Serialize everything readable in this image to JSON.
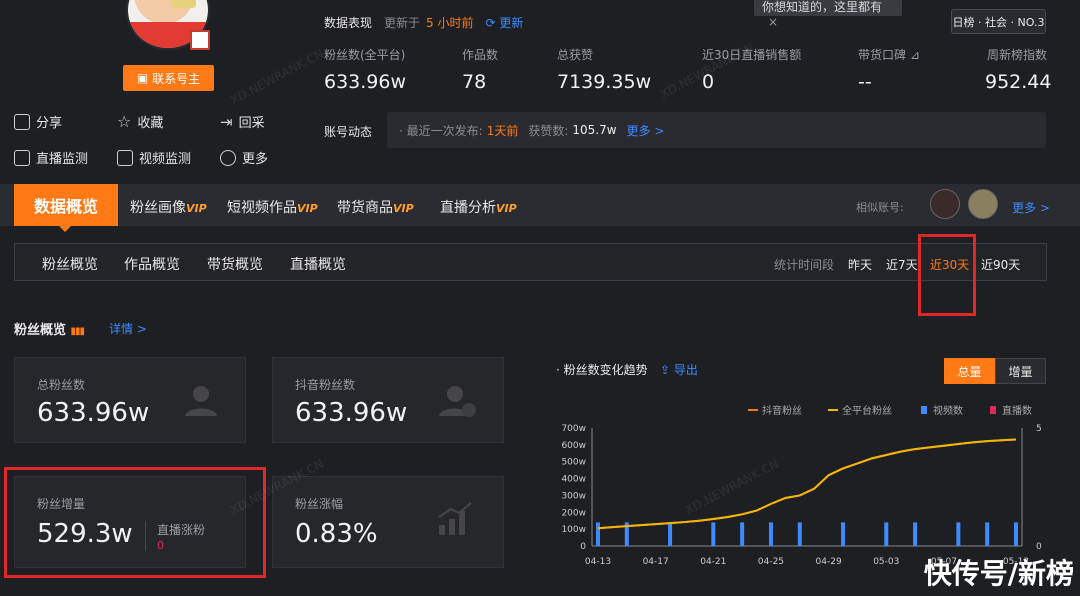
{
  "tooltip": "你想知道的，这里都有",
  "contact_button": "联系号主",
  "actions": [
    "分享",
    "收藏",
    "回采",
    "直播监测",
    "视频监测",
    "更多"
  ],
  "perf": {
    "label": "数据表现",
    "updated_prefix": "更新于",
    "updated_time": "5 小时前",
    "refresh": "更新"
  },
  "rank_badge": "日榜 · 社会 · NO.3",
  "stats": [
    {
      "label": "粉丝数(全平台)",
      "value": "633.96w"
    },
    {
      "label": "作品数",
      "value": "78"
    },
    {
      "label": "总获赞",
      "value": "7139.35w"
    },
    {
      "label": "近30日直播销售额",
      "value": "0"
    },
    {
      "label": "带货口碑",
      "value": "--"
    },
    {
      "label": "周新榜指数",
      "value": "952.44"
    }
  ],
  "dynamic": {
    "label": "账号动态",
    "last_post_prefix": "· 最近一次发布:",
    "last_post": "1天前",
    "likes_label": "获赞数:",
    "likes": "105.7w",
    "more": "更多 >"
  },
  "main_tabs": [
    {
      "label": "数据概览",
      "vip": ""
    },
    {
      "label": "粉丝画像",
      "vip": "VIP"
    },
    {
      "label": "短视频作品",
      "vip": "VIP"
    },
    {
      "label": "带货商品",
      "vip": "VIP"
    },
    {
      "label": "直播分析",
      "vip": "VIP"
    }
  ],
  "similar": {
    "label": "相似账号:",
    "more": "更多 >"
  },
  "sub_tabs": [
    "粉丝概览",
    "作品概览",
    "带货概览",
    "直播概览"
  ],
  "period": {
    "label": "统计时间段",
    "options": [
      "昨天",
      "近7天",
      "近30天",
      "近90天"
    ],
    "selected": "近30天"
  },
  "section": {
    "title": "粉丝概览",
    "detail": "详情 >"
  },
  "cards": [
    {
      "label": "总粉丝数",
      "value": "633.96w"
    },
    {
      "label": "抖音粉丝数",
      "value": "633.96w"
    },
    {
      "label": "粉丝增量",
      "value": "529.3w",
      "sub_label": "直播涨粉",
      "sub_value": "0"
    },
    {
      "label": "粉丝涨幅",
      "value": "0.83%"
    }
  ],
  "trend": {
    "title": "粉丝数变化趋势",
    "export": "导出",
    "toggle": [
      "总量",
      "增量"
    ],
    "active": "总量"
  },
  "watermarks": [
    "XD.NEWRANK.CN",
    "XD.NEWRANK.CN",
    "XD.NEWRANK.CN",
    "XD.NEWRANK.CN"
  ],
  "footer": "快传号/新榜",
  "colors": {
    "accent": "#ff7a14",
    "highlight_box": "#e0282a",
    "douyin_line": "#ff7a14",
    "all_line": "#f2b705",
    "video_bar": "#3d8bff",
    "live_bar": "#e0285a"
  },
  "chart_data": {
    "type": "line",
    "title": "",
    "legend": [
      "抖音粉丝",
      "全平台粉丝",
      "视频数",
      "直播数"
    ],
    "legend_position": "top-right",
    "x": [
      "04-13",
      "04-14",
      "04-15",
      "04-16",
      "04-17",
      "04-18",
      "04-19",
      "04-20",
      "04-21",
      "04-22",
      "04-23",
      "04-24",
      "04-25",
      "04-26",
      "04-27",
      "04-28",
      "04-29",
      "04-30",
      "05-01",
      "05-02",
      "05-03",
      "05-04",
      "05-05",
      "05-06",
      "05-07",
      "05-08",
      "05-09",
      "05-10",
      "05-11",
      "05-12"
    ],
    "x_tick_labels": [
      "04-13",
      "04-17",
      "04-21",
      "04-25",
      "04-29",
      "05-03",
      "05-07",
      "05-12"
    ],
    "y_left_ticks": [
      "0",
      "100w",
      "200w",
      "300w",
      "400w",
      "500w",
      "600w",
      "700w"
    ],
    "y_left_range": [
      0,
      700
    ],
    "y_right_ticks": [
      "0",
      "5"
    ],
    "y_right_range": [
      0,
      5
    ],
    "series": [
      {
        "name": "抖音粉丝",
        "axis": "left",
        "values": [
          105,
          112,
          118,
          124,
          130,
          136,
          142,
          150,
          160,
          172,
          188,
          210,
          250,
          285,
          300,
          340,
          420,
          460,
          490,
          520,
          540,
          560,
          575,
          585,
          595,
          605,
          615,
          622,
          627,
          632
        ]
      },
      {
        "name": "全平台粉丝",
        "axis": "left",
        "values": [
          105,
          112,
          118,
          124,
          130,
          136,
          142,
          150,
          160,
          172,
          188,
          210,
          250,
          285,
          300,
          340,
          420,
          460,
          490,
          520,
          540,
          560,
          575,
          585,
          595,
          605,
          615,
          622,
          627,
          632
        ]
      },
      {
        "name": "视频数",
        "axis": "right",
        "type": "bar",
        "values": [
          1,
          0,
          1,
          0,
          0,
          1,
          0,
          0,
          1,
          0,
          1,
          0,
          1,
          0,
          1,
          0,
          0,
          1,
          0,
          0,
          1,
          0,
          1,
          0,
          0,
          1,
          0,
          1,
          0,
          1
        ]
      },
      {
        "name": "直播数",
        "axis": "right",
        "type": "bar",
        "values": [
          0,
          0,
          0,
          0,
          0,
          0,
          0,
          0,
          0,
          0,
          0,
          0,
          0,
          0,
          0,
          0,
          0,
          0,
          0,
          0,
          0,
          0,
          0,
          0,
          0,
          0,
          0,
          0,
          0,
          0
        ]
      }
    ]
  }
}
